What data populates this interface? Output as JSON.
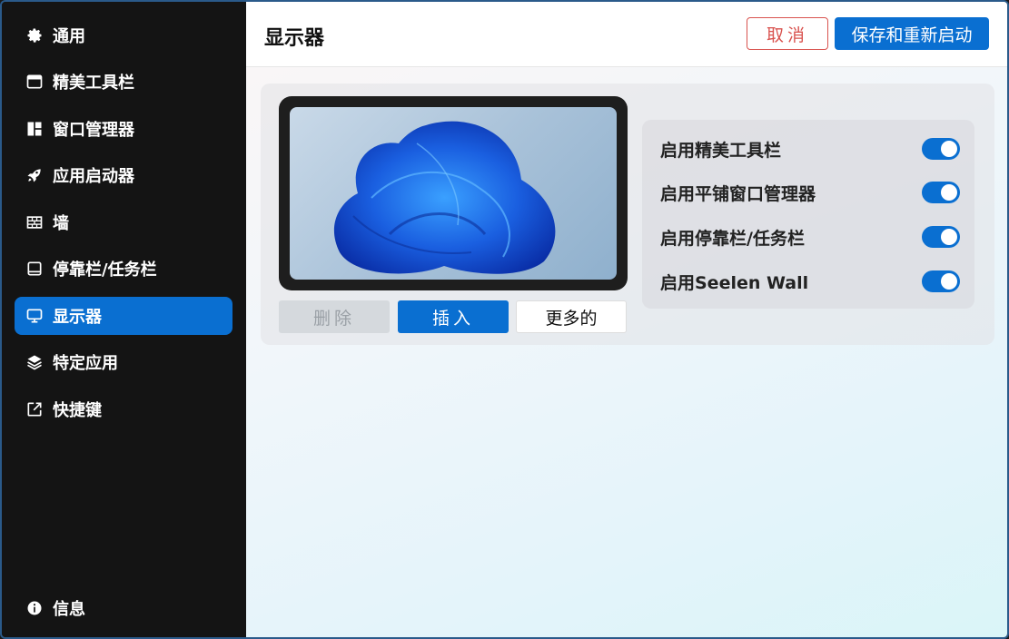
{
  "sidebar": {
    "items": [
      {
        "label": "通用",
        "icon": "gear-icon"
      },
      {
        "label": "精美工具栏",
        "icon": "window-bar-icon"
      },
      {
        "label": "窗口管理器",
        "icon": "tiles-icon"
      },
      {
        "label": "应用启动器",
        "icon": "rocket-icon"
      },
      {
        "label": "墙",
        "icon": "brick-wall-icon"
      },
      {
        "label": "停靠栏/任务栏",
        "icon": "dock-icon"
      },
      {
        "label": "显示器",
        "icon": "monitor-icon",
        "active": true
      },
      {
        "label": "特定应用",
        "icon": "layers-icon"
      },
      {
        "label": "快捷键",
        "icon": "external-link-icon"
      }
    ],
    "info": {
      "label": "信息",
      "icon": "info-icon"
    }
  },
  "header": {
    "title": "显示器",
    "cancel_label": "取消",
    "save_label": "保存和重新启动"
  },
  "monitor": {
    "delete_label": "删除",
    "insert_label": "插入",
    "more_label": "更多的"
  },
  "toggles": [
    {
      "label": "启用精美工具栏",
      "on": true
    },
    {
      "label": "启用平铺窗口管理器",
      "on": true
    },
    {
      "label": "启用停靠栏/任务栏",
      "on": true
    },
    {
      "label": "启用Seelen Wall",
      "on": true
    }
  ],
  "colors": {
    "accent": "#0a6fd1",
    "sidebar_bg": "#141414",
    "cancel": "#d9534f"
  }
}
